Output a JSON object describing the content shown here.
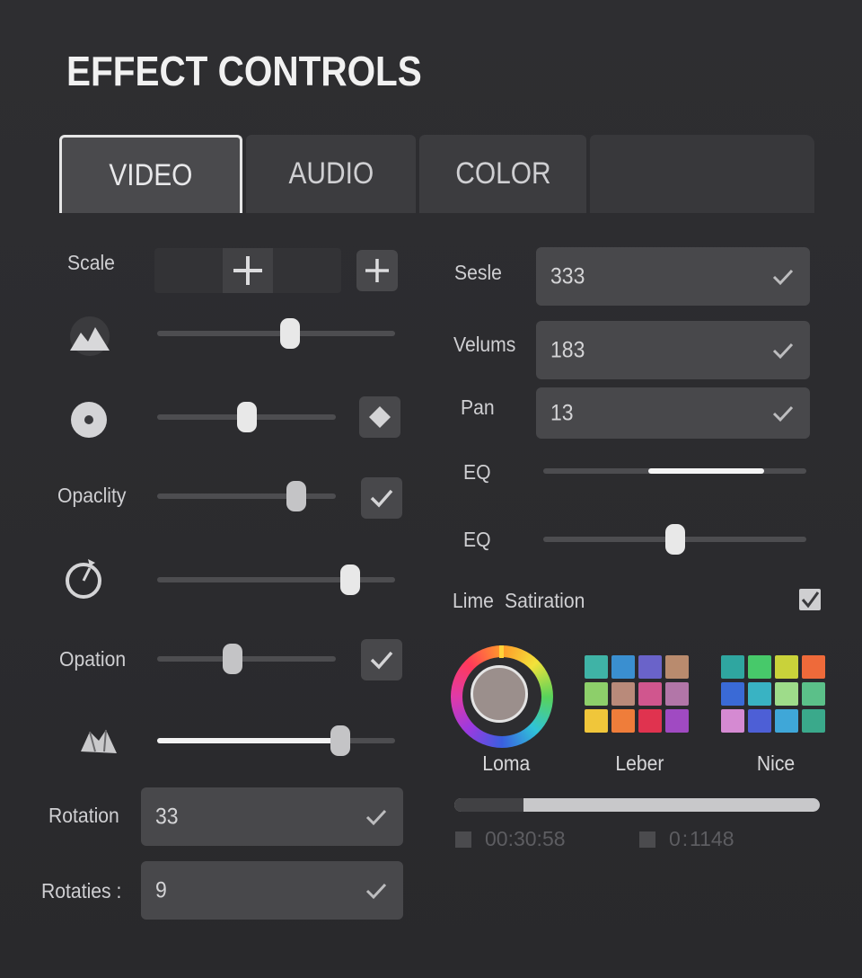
{
  "title": "EFFECT CONTROLS",
  "tabs": [
    {
      "label": "VIDEO",
      "active": true
    },
    {
      "label": "AUDIO",
      "active": false
    },
    {
      "label": "COLOR",
      "active": false
    },
    {
      "label": "",
      "active": false
    }
  ],
  "left": {
    "scale_label": "Scale",
    "opacity_label": "Opaclity",
    "opation_label": "Opation",
    "rotation_label": "Rotation",
    "rotation_value": "33",
    "rotaties_label": "Rotaties :",
    "rotaties_value": "9",
    "sliders": [
      {
        "name": "mountain-slider",
        "value": 0.56
      },
      {
        "name": "circle-slider",
        "value": 0.5
      },
      {
        "name": "opacity-slider",
        "value": 0.78
      },
      {
        "name": "timer-slider",
        "value": 0.81
      },
      {
        "name": "opation-slider",
        "value": 0.42
      },
      {
        "name": "shape-slider",
        "value": 0.77
      }
    ]
  },
  "right": {
    "sesle_label": "Sesle",
    "sesle_value": "333",
    "velums_label": "Velums",
    "velums_value": "183",
    "pan_label": "Pan",
    "pan_value": "13",
    "eq1_label": "EQ",
    "eq1_range": [
      0.4,
      0.84
    ],
    "eq2_label": "EQ",
    "eq2_value": 0.5,
    "lime_label": "Lime",
    "saturation_label": "Satiration",
    "saturation_checked": true,
    "wheel_caption": "Loma",
    "grid1_caption": "Leber",
    "grid2_caption": "Nice",
    "progress": 0.19,
    "time_start": "00:30:58",
    "time_end": "0 : 1148"
  },
  "colors": {
    "grid1": [
      "#3fb3a6",
      "#3a8fd0",
      "#6a63c9",
      "#b98b6e",
      "#8dcf6a",
      "#b98a7a",
      "#d0568e",
      "#b276a8",
      "#f0c63a",
      "#ef7d3a",
      "#e0334f",
      "#a04ac2"
    ],
    "grid2": [
      "#2fa6a0",
      "#47c96a",
      "#c9d23a",
      "#ee6a3a",
      "#3a6ad6",
      "#39b3c3",
      "#9edc8a",
      "#5bc089",
      "#d58ad2",
      "#4d5fd6",
      "#3fa7d8",
      "#3aa98b"
    ]
  }
}
